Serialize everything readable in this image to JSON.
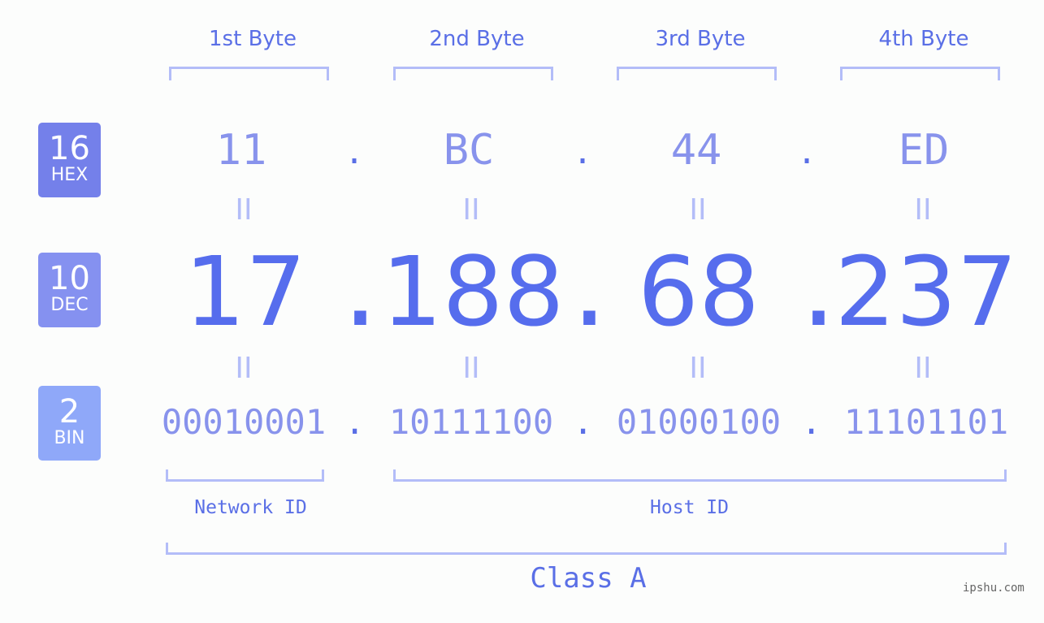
{
  "badges": [
    {
      "number": "16",
      "label": "HEX",
      "color": "#7480ea"
    },
    {
      "number": "10",
      "label": "DEC",
      "color": "#8591f0"
    },
    {
      "number": "2",
      "label": "BIN",
      "color": "#8fa8f9"
    }
  ],
  "byte_headers": [
    "1st Byte",
    "2nd Byte",
    "3rd Byte",
    "4th Byte"
  ],
  "hex": [
    "11",
    "BC",
    "44",
    "ED"
  ],
  "dec": [
    "17",
    "188",
    "68",
    "237"
  ],
  "bin": [
    "00010001",
    "10111100",
    "01000100",
    "11101101"
  ],
  "separator": ".",
  "equals": "II",
  "network_label": "Network ID",
  "host_label": "Host ID",
  "class_label": "Class A",
  "watermark": "ipshu.com"
}
